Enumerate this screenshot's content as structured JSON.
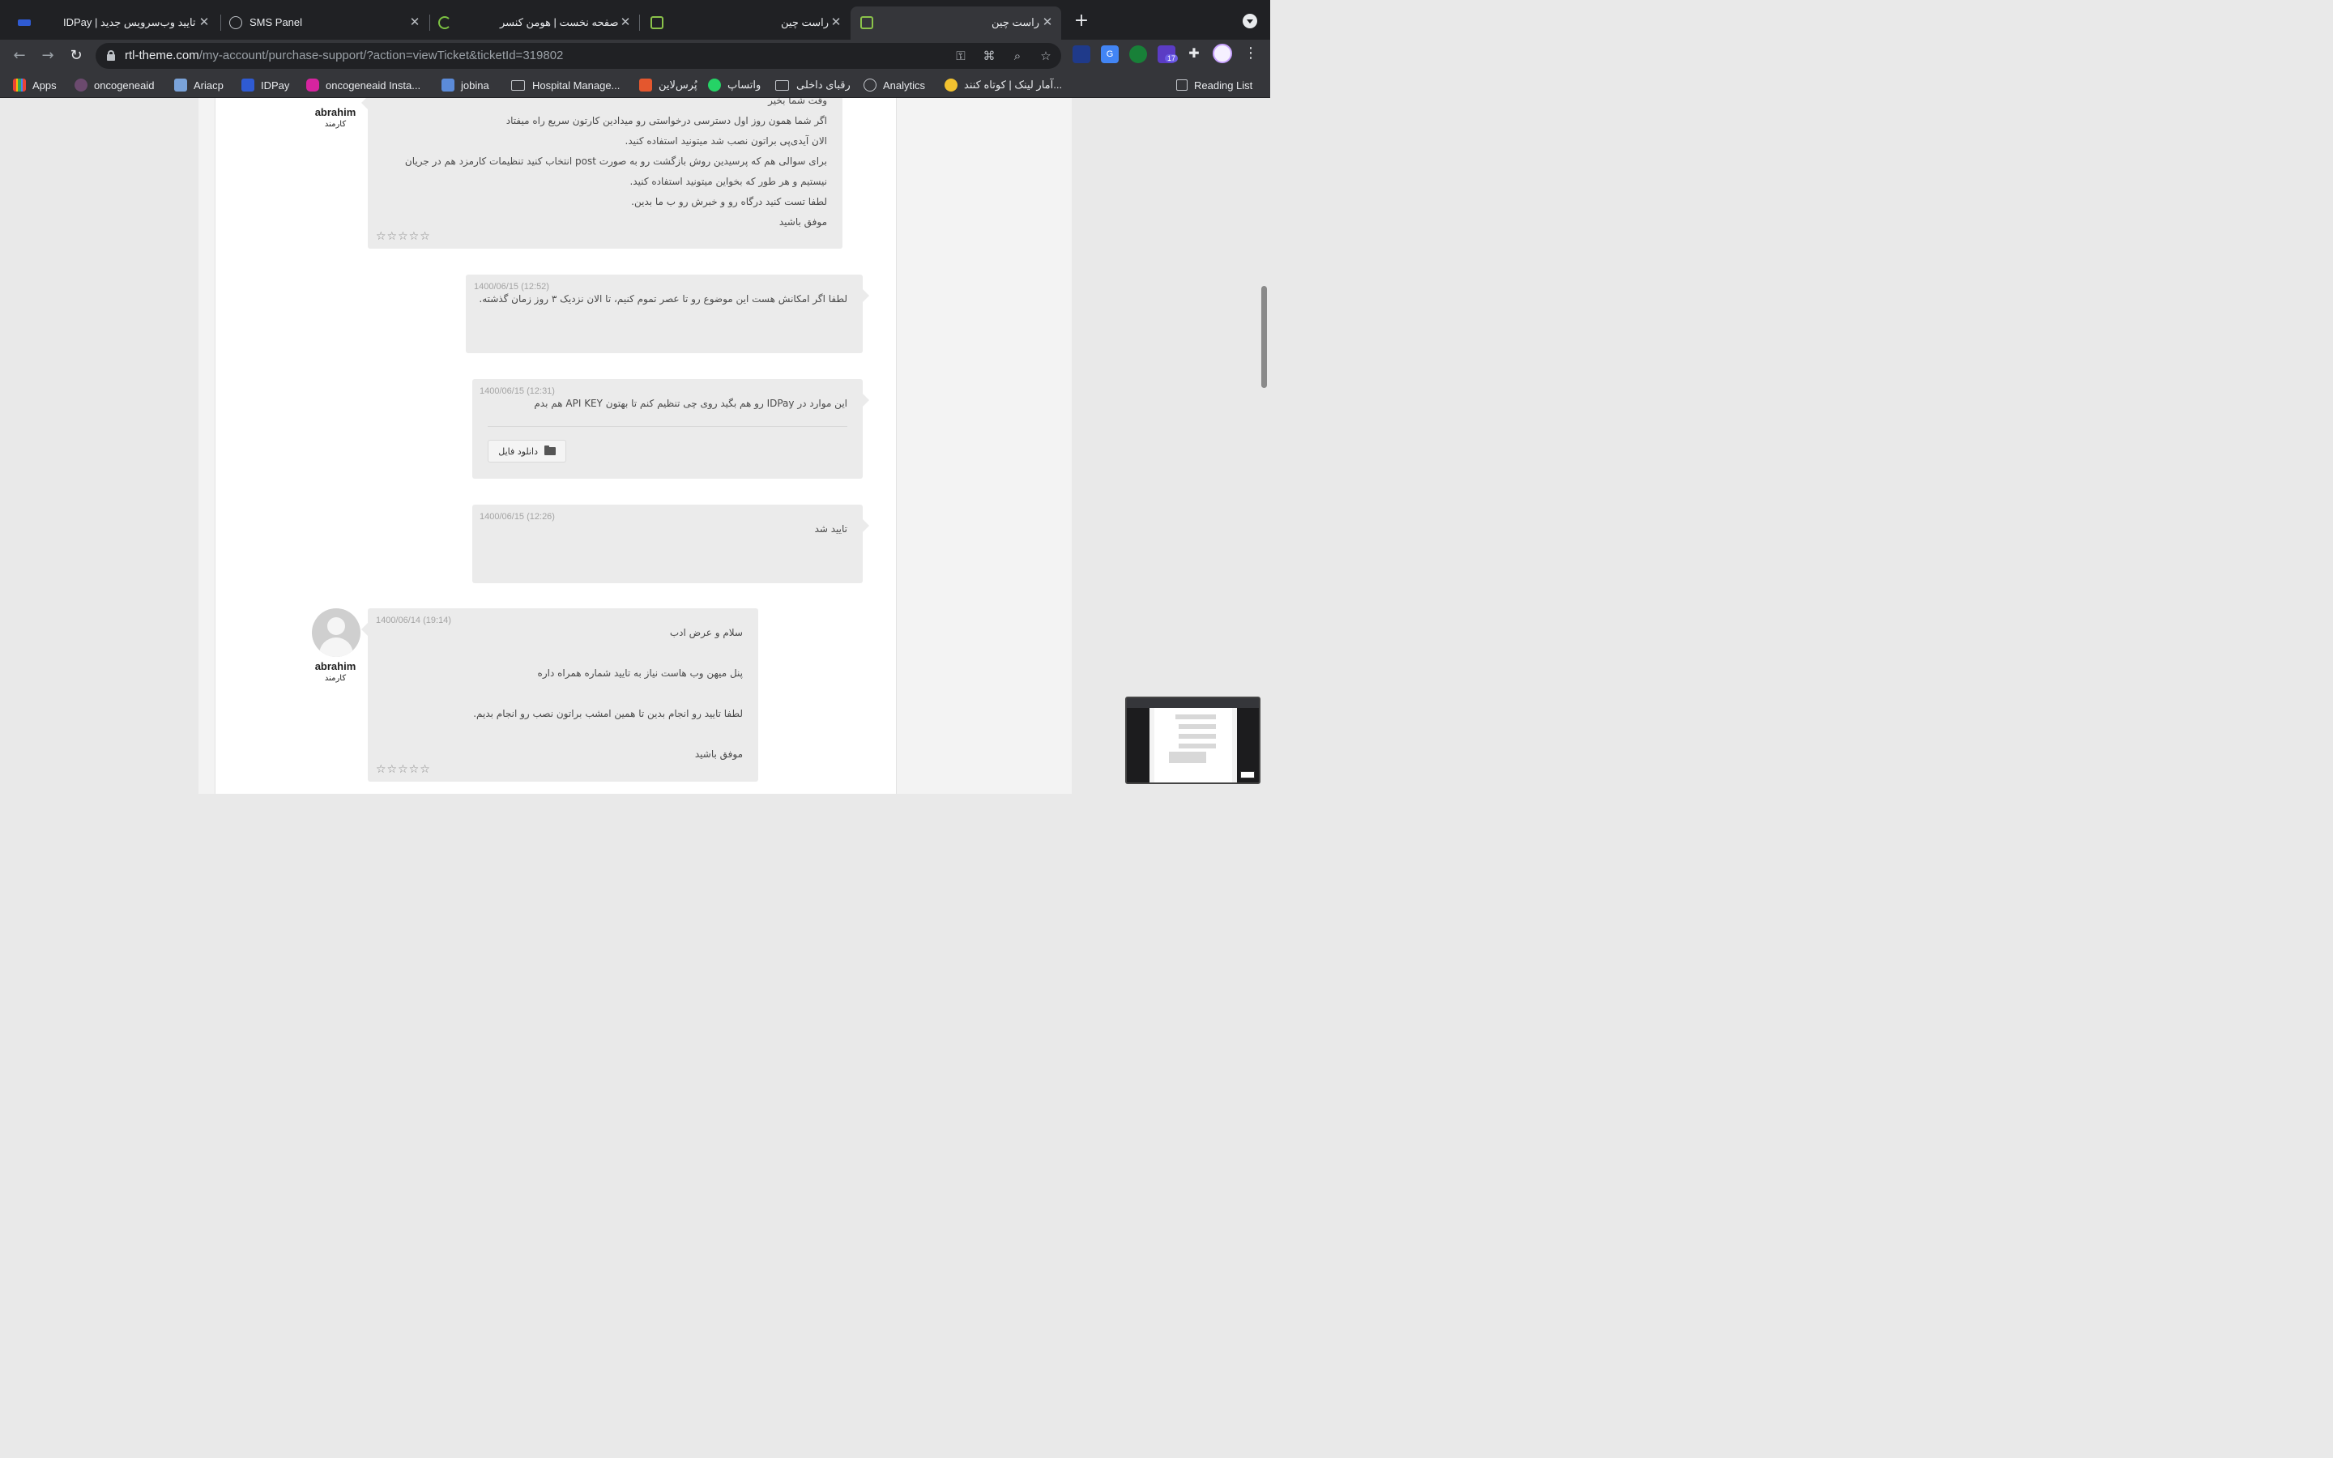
{
  "browser": {
    "tabs": [
      {
        "title": "تایید وب‌سرویس جدید | IDPay",
        "active": false
      },
      {
        "title": "SMS Panel",
        "active": false
      },
      {
        "title": "صفحه نخست | هومن کنسر",
        "active": false
      },
      {
        "title": "",
        "active": false
      },
      {
        "title": "راست چین",
        "active": false
      },
      {
        "title": "راست چین",
        "active": true
      }
    ],
    "url_host": "rtl-theme.com",
    "url_path": "/my-account/purchase-support/?action=viewTicket&ticketId=319802",
    "extension_badge": "17",
    "bookmarks": [
      "Apps",
      "oncogeneaid",
      "Ariacp",
      "IDPay",
      "oncogeneaid Insta...",
      "jobina",
      "Hospital Manage...",
      "پُرس‌لاین",
      "واتساپ",
      "رقبای داخلی",
      "Analytics",
      "آمار لینک | کوتاه کنند...",
      "Reading List"
    ]
  },
  "ticket": {
    "staff_reply_1": {
      "author": "abrahim",
      "role": "کارمند",
      "lines": [
        "وقت شما بخیر",
        "اگر شما همون روز اول دسترسی درخواستی رو میدادین کارتون سریع راه میفتاد",
        "الان آیدی‌پی براتون نصب شد میتونید استفاده کنید.",
        "برای سوالی هم که پرسیدین روش بازگشت رو به صورت post انتخاب کنید تنظیمات کارمزد هم در جریان",
        "نیستیم و هر طور که بخواین میتونید استفاده کنید.",
        "لطفا تست کنید درگاه رو و خبرش رو ب ما بدین.",
        "موفق باشید"
      ],
      "rating": "☆☆☆☆☆"
    },
    "user_message_1": {
      "date": "1400/06/15 (12:52)",
      "text": "لطفا اگر امکانش هست این موضوع رو تا عصر تموم کنیم، تا الان نزدیک ۳ روز زمان گذشته."
    },
    "user_message_2": {
      "date": "1400/06/15 (12:31)",
      "text": "این موارد در IDPay رو هم بگید روی چی تنظیم کنم تا بهتون API KEY هم بدم",
      "download_label": "دانلود فایل"
    },
    "user_message_3": {
      "date": "1400/06/15 (12:26)",
      "text": "تایید شد"
    },
    "staff_reply_2": {
      "author": "abrahim",
      "role": "کارمند",
      "date": "1400/06/14 (19:14)",
      "lines": [
        "سلام و عرض ادب",
        "پنل میهن وب هاست نیاز به تایید شماره همراه داره",
        "لطفا تایید رو انجام بدین تا همین امشب براتون نصب رو انجام بدیم.",
        "موفق باشید"
      ],
      "rating": "☆☆☆☆☆"
    }
  }
}
